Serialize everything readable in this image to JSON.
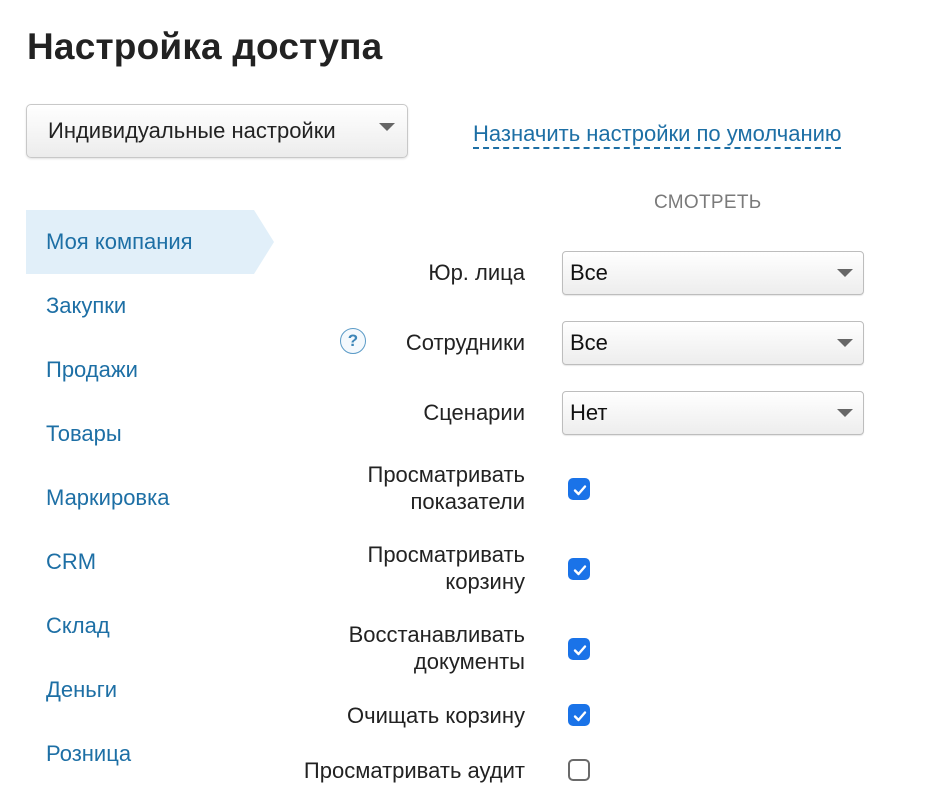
{
  "page": {
    "title": "Настройка доступа"
  },
  "preset": {
    "value": "Индивидуальные настройки",
    "icon": "chevron-down-icon"
  },
  "default_link": "Назначить настройки по умолчанию",
  "column_header": "СМОТРЕТЬ",
  "sidebar": {
    "active_index": 0,
    "items": [
      {
        "label": "Моя компания"
      },
      {
        "label": "Закупки"
      },
      {
        "label": "Продажи"
      },
      {
        "label": "Товары"
      },
      {
        "label": "Маркировка"
      },
      {
        "label": "CRM"
      },
      {
        "label": "Склад"
      },
      {
        "label": "Деньги"
      },
      {
        "label": "Розница"
      }
    ]
  },
  "fields": {
    "legal_entities": {
      "label": "Юр. лица",
      "value": "Все"
    },
    "employees": {
      "label": "Сотрудники",
      "value": "Все",
      "help_icon": "?"
    },
    "scenarios": {
      "label": "Сценарии",
      "value": "Нет"
    }
  },
  "permissions": [
    {
      "label_line1": "Просматривать",
      "label_line2": "показатели",
      "checked": true
    },
    {
      "label_line1": "Просматривать",
      "label_line2": "корзину",
      "checked": true
    },
    {
      "label_line1": "Восстанавливать",
      "label_line2": "документы",
      "checked": true
    },
    {
      "label_line1": "Очищать корзину",
      "label_line2": "",
      "checked": true
    },
    {
      "label_line1": "Просматривать аудит",
      "label_line2": "",
      "checked": false
    }
  ],
  "colors": {
    "link": "#1d6fa5",
    "active_bg": "#e1eff9",
    "checkbox": "#1a73e8"
  }
}
